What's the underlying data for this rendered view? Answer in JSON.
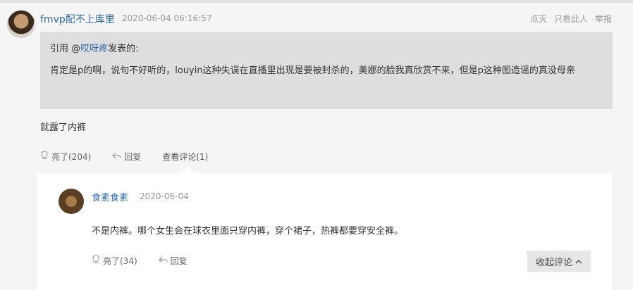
{
  "post": {
    "username": "fmvp配不上库里",
    "timestamp": "2020-06-04 06:16:57",
    "actions": [
      "点灭",
      "只看此人",
      "举报"
    ],
    "quote": {
      "prefix": "引用 @",
      "author": "哎呀疼",
      "suffix": "发表的:",
      "text": "肯定是p的啊，说句不好听的，louyin这种失误在直播里出现是要被封杀的，美娜的脸我真欣赏不来，但是p这种图造谣的真没母亲"
    },
    "reply_text": "就露了内裤",
    "bar": {
      "like_label": "亮了(204)",
      "reply_label": "回复",
      "view_comments_label": "查看评论(1)"
    }
  },
  "comment": {
    "username": "食素食素",
    "date": "2020-06-04",
    "text": "不是内裤。哪个女生会在球衣里面只穿内裤，穿个裙子，热裤都要穿安全裤。",
    "like_label": "亮了(34)",
    "reply_label": "回复",
    "collapse_label": "收起评论"
  },
  "icons": {
    "like": "lightbulb-icon",
    "reply": "reply-arrow-icon",
    "collapse": "chevron-up-icon"
  }
}
